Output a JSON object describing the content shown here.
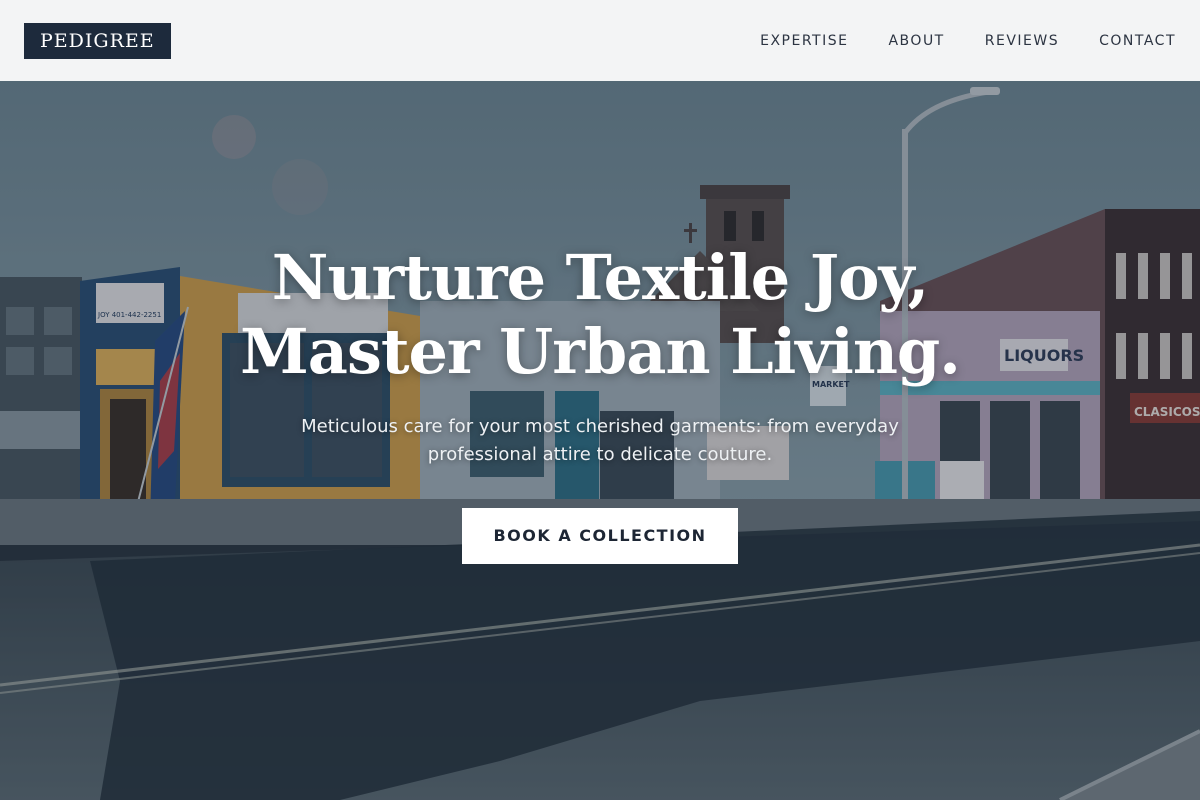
{
  "header": {
    "logo": "PEDIGREE",
    "nav": [
      {
        "label": "EXPERTISE"
      },
      {
        "label": "ABOUT"
      },
      {
        "label": "REVIEWS"
      },
      {
        "label": "CONTACT"
      }
    ]
  },
  "hero": {
    "headline_line1": "Nurture Textile Joy,",
    "headline_line2": "Master Urban Living.",
    "subtext": "Meticulous care for your most cherished garments: from everyday professional attire to delicate couture.",
    "cta_label": "BOOK A COLLECTION",
    "background": {
      "sign_left": "JOY 401-442-2251",
      "sign_market": "MARKET",
      "sign_liquors": "LIQUORS",
      "sign_clasicos": "CLASICOS"
    }
  },
  "colors": {
    "header_bg": "#f3f4f5",
    "logo_bg": "#1d2a3c",
    "nav_text": "#2c3442",
    "cta_bg": "#ffffff",
    "cta_text": "#1d2634"
  }
}
